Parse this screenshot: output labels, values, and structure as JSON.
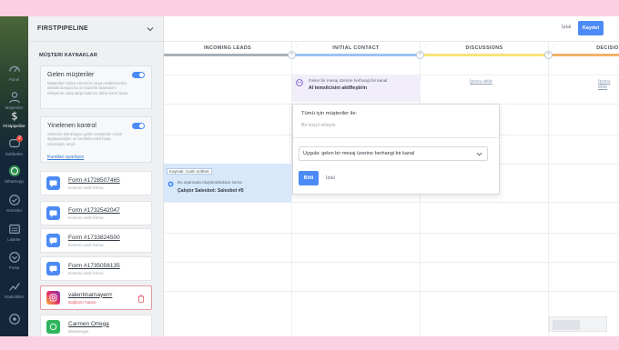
{
  "nav": {
    "items": [
      {
        "label": "Panel",
        "icon": "dashboard-icon"
      },
      {
        "label": "Müşteriler",
        "icon": "user-icon"
      },
      {
        "label": "Firstpipeline",
        "icon": "dollar-icon",
        "active": true
      },
      {
        "label": "Sohbetler",
        "icon": "chat-icon",
        "badge": "2"
      },
      {
        "label": "WhatsApp",
        "icon": "whatsapp-icon"
      },
      {
        "label": "Görevler",
        "icon": "check-icon"
      },
      {
        "label": "Listeler",
        "icon": "list-icon"
      },
      {
        "label": "Posta",
        "icon": "mail-icon"
      },
      {
        "label": "İstatistikler",
        "icon": "stats-icon"
      },
      {
        "label": "",
        "icon": "settings-icon"
      }
    ]
  },
  "sidebar": {
    "title": "FIRSTPIPELINE",
    "section_title": "MÜŞTERI KAYNAKLAR",
    "cards": [
      {
        "title": "Gelen müşteriler",
        "description": "Müşterileri kabul etmenize veya reddetmenize olanak tanıyan bu ön hazırlık aşamasını ekleyerek satış takip hattınızı daha temiz tutun.",
        "toggle": true
      },
      {
        "title": "Yinelenen kontrol",
        "description": "Sistemin tekrarlayan gelen müşterileri nasıl algılayacağını ve bunlarla nasıl başa çıkacağını seçin",
        "link": "Kuralları ayarlayın",
        "toggle": true
      }
    ],
    "sources": [
      {
        "name": "Form #1728507465",
        "sub": "Kommo web formu",
        "type": "form"
      },
      {
        "name": "Form #1732542047",
        "sub": "Kommo web formu",
        "type": "form"
      },
      {
        "name": "Form #1733824500",
        "sub": "Kommo web formu",
        "type": "form"
      },
      {
        "name": "Form #1735056135",
        "sub": "Kommo web formu",
        "type": "form"
      },
      {
        "name": "valentinamayerrr",
        "sub": "Bağlantı hatası",
        "type": "instagram",
        "error": true
      },
      {
        "name": "Carmen Ortega",
        "sub": "Messenger",
        "type": "whatsapp"
      }
    ]
  },
  "toolbar": {
    "cancel_label": "İptal",
    "save_label": "Kaydet"
  },
  "columns": [
    {
      "title": "INCOMING LEADS",
      "color": "#a9b0b7"
    },
    {
      "title": "INITIAL CONTACT",
      "color": "#9cc3f5"
    },
    {
      "title": "DISCUSSIONS",
      "color": "#f5e37a"
    },
    {
      "title": "DECISION M",
      "color": "#f2b36b"
    }
  ],
  "hint_label": "İpucu ekle",
  "trigger_ai": {
    "line1": "Gelen bir mesaj üzerine herhangi bir kanal",
    "line2": "AI temsilcisini aktifleştirin"
  },
  "popup": {
    "title": "Tümü için müşteriler ile:",
    "condition_placeholder": "Bir koşul ekleyin",
    "select_label": "Uygula:",
    "select_value": "gelen bir mesaj üzerine herhangi bir kanal",
    "done_label": "Bitti",
    "cancel_label": "İptal"
  },
  "trigger_bot": {
    "tag": "Kaynak: Canlı sohbet",
    "line1": "Bu aşamada oluşturulduktan sonra",
    "line2": "Çalıştır Salesbot: Salesbot #5"
  },
  "colors": {
    "accent": "#4c8bf5",
    "nav_bg": "#14263a",
    "sidebar_bg": "#eef0f2",
    "error": "#e0596b"
  }
}
